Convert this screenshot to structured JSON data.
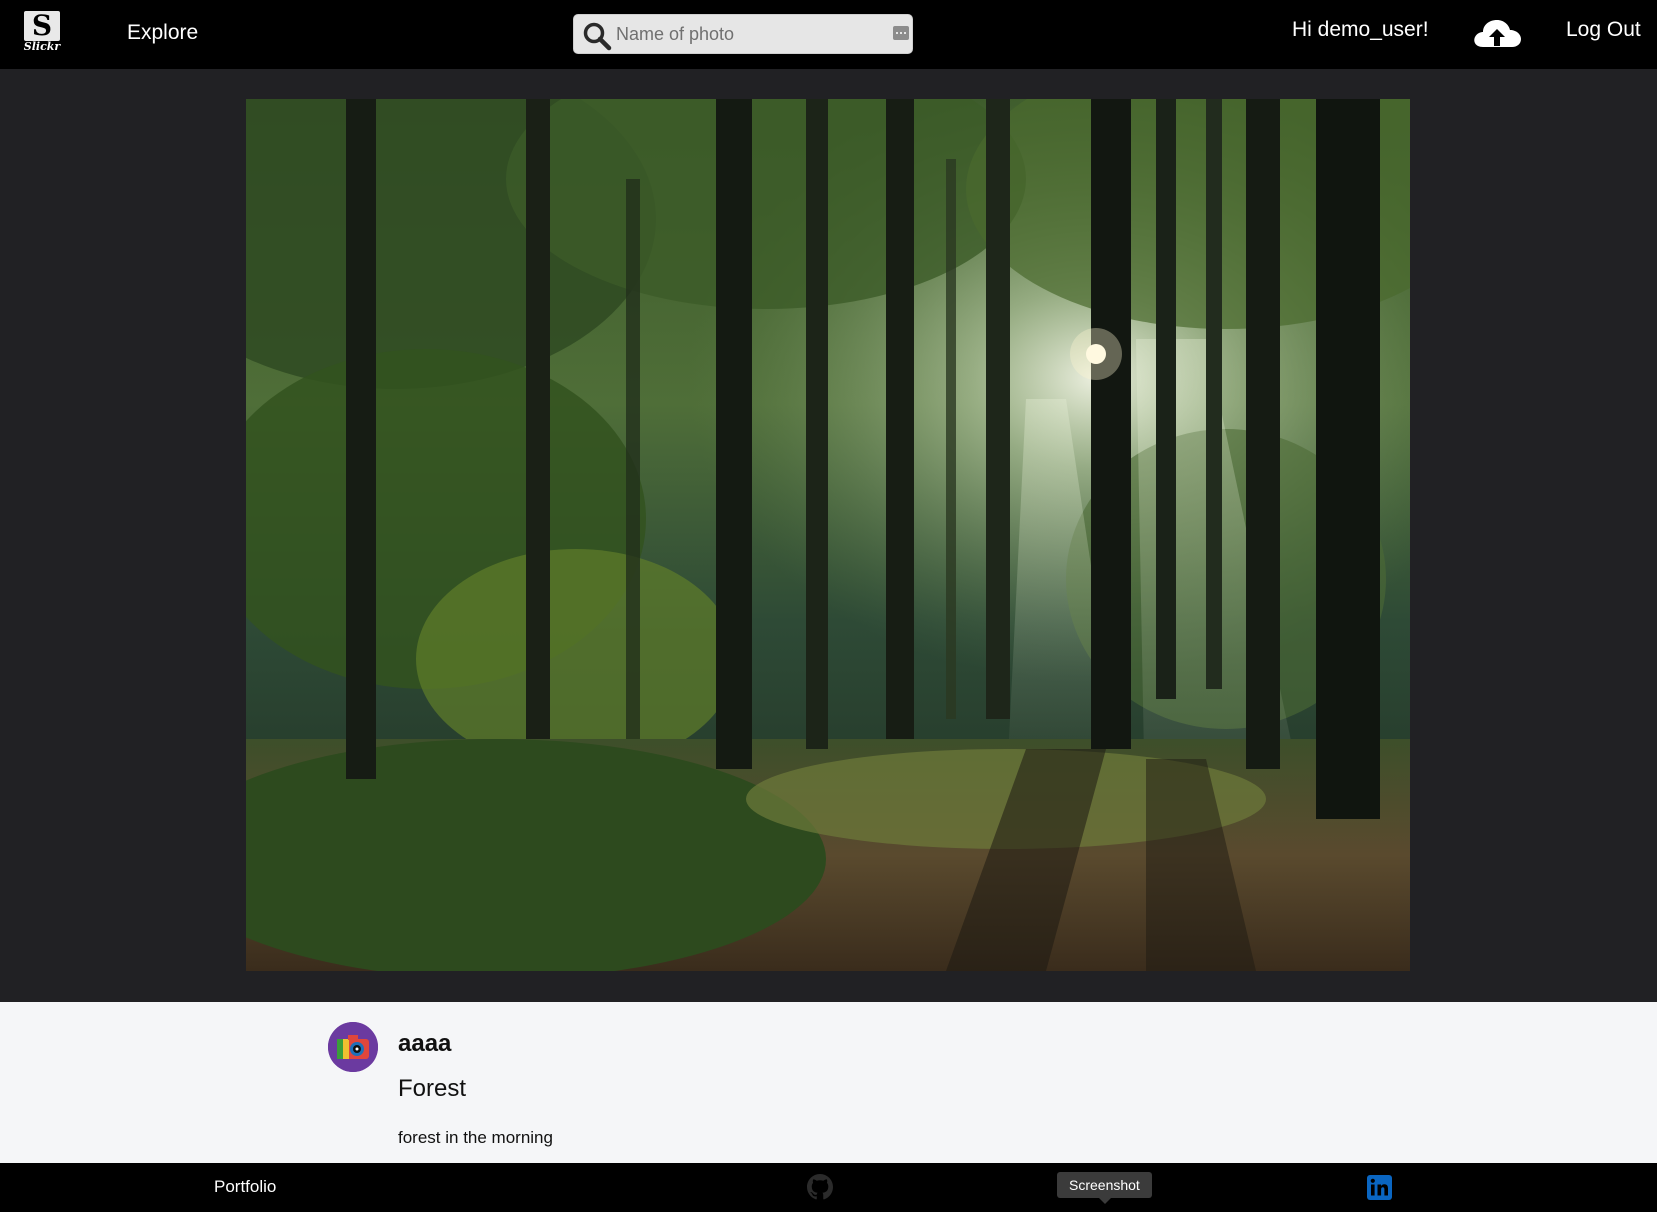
{
  "nav": {
    "logo_letter": "S",
    "logo_word": "Slickr",
    "explore": "Explore",
    "search_placeholder": "Name of photo",
    "search_value": "",
    "greeting": "Hi demo_user!",
    "upload_icon": "cloud-upload-icon",
    "logout": "Log Out"
  },
  "photo": {
    "subject": "sunlit forest with tall trees",
    "image_icon": "forest-photo"
  },
  "details": {
    "author": "aaaa",
    "title": "Forest",
    "description": "forest in the morning",
    "avatar_icon": "camera-avatar-icon"
  },
  "footer": {
    "portfolio": "Portfolio",
    "github_icon": "github-icon",
    "tooltip": "Screenshot",
    "linkedin_icon": "linkedin-icon"
  },
  "colors": {
    "nav_bg": "#000000",
    "stage_bg": "#212124",
    "details_bg": "#f5f6f8",
    "avatar_bg": "#6b3aa0",
    "linkedin_blue": "#0a66c2"
  }
}
